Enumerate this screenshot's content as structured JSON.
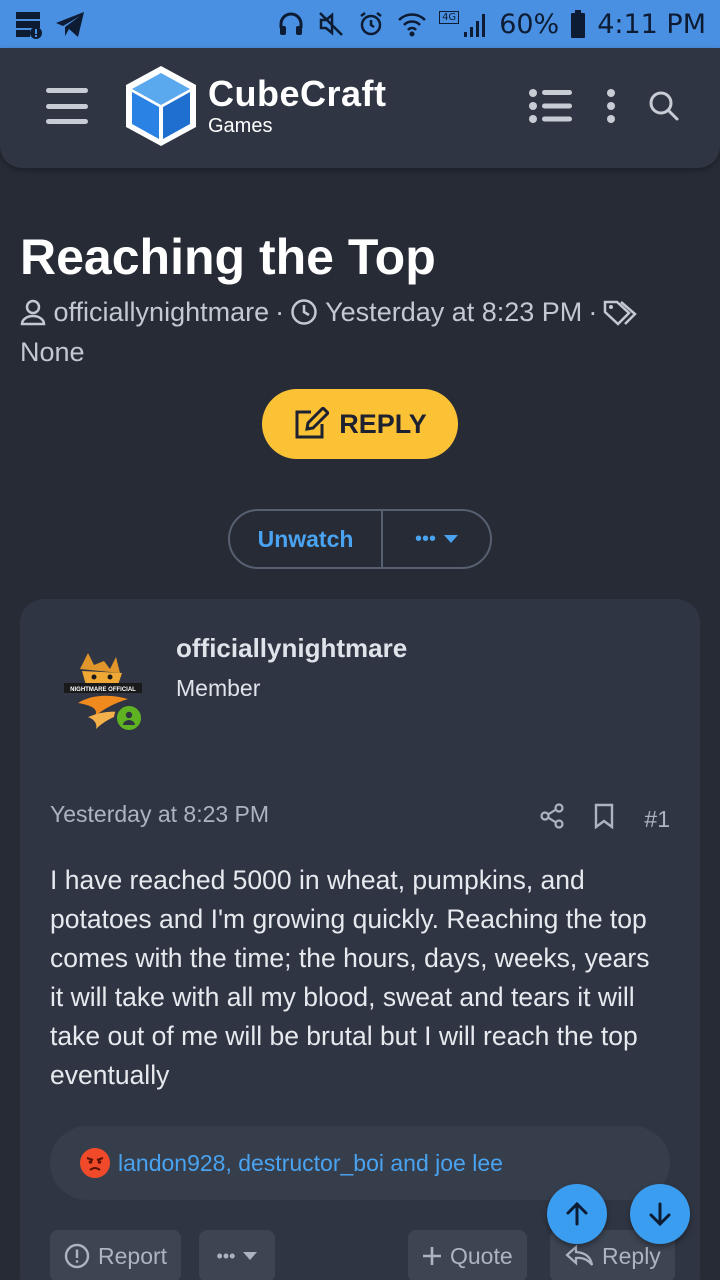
{
  "status_bar": {
    "battery": "60%",
    "time": "4:11 PM",
    "network": "4G"
  },
  "header": {
    "logo_title": "CubeCraft",
    "logo_subtitle": "Games",
    "icons": [
      "menu-icon",
      "list-icon",
      "kebab-icon",
      "search-icon"
    ]
  },
  "thread": {
    "title": "Reaching the Top",
    "author": "officiallynightmare",
    "date": "Yesterday at 8:23 PM",
    "tags": "None",
    "reply_label": "REPLY",
    "unwatch_label": "Unwatch",
    "more_label": "•••"
  },
  "post": {
    "author": "officiallynightmare",
    "role": "Member",
    "avatar_text": "NIGHTMARE OFFICIAL",
    "date": "Yesterday at 8:23 PM",
    "number": "#1",
    "body": "I have reached 5000 in wheat, pumpkins, and potatoes and I'm growing quickly. Reaching the top comes with the time; the hours, days, weeks, years it will take with all my blood, sweat and tears it will take out of me will be brutal but I will reach the top eventually",
    "reactions": "landon928, destructor_boi and joe lee"
  },
  "footer": {
    "report_label": "Report",
    "more_label": "•••",
    "quote_label": "Quote",
    "reply_label": "Reply"
  },
  "colors": {
    "accent": "#fcc236",
    "link": "#4aa3f0",
    "status_bar": "#4a90e2",
    "background": "#262b36",
    "card": "#2f3542"
  }
}
